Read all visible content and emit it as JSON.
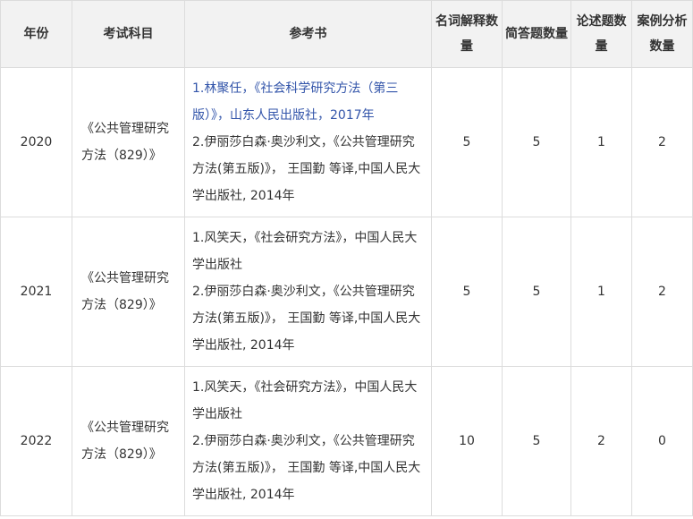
{
  "headers": [
    "年份",
    "考试科目",
    "参考书",
    "名词解释数量",
    "简答题数量",
    "论述题数量",
    "案例分析数量"
  ],
  "rows": [
    {
      "year": "2020",
      "subject": "《公共管理研究方法（829）》",
      "books": [
        "1.林聚任，《社会科学研究方法（第三版）》，山东人民出版社，2017年",
        "2.伊丽莎白森·奥沙利文，《公共管理研究方法(第五版)》， 王国勤 等译,中国人民大学出版社, 2014年"
      ],
      "noun": "5",
      "short": "5",
      "essay": "1",
      "case": "2"
    },
    {
      "year": "2021",
      "subject": "《公共管理研究方法（829）》",
      "books": [
        "1.风笑天，《社会研究方法》，中国人民大学出版社",
        "2.伊丽莎白森·奥沙利文，《公共管理研究方法(第五版)》， 王国勤 等译,中国人民大学出版社, 2014年"
      ],
      "noun": "5",
      "short": "5",
      "essay": "1",
      "case": "2"
    },
    {
      "year": "2022",
      "subject": "《公共管理研究方法（829）》",
      "books": [
        "1.风笑天，《社会研究方法》，中国人民大学出版社",
        "2.伊丽莎白森·奥沙利文，《公共管理研究方法(第五版)》， 王国勤 等译,中国人民大学出版社, 2014年"
      ],
      "noun": "10",
      "short": "5",
      "essay": "2",
      "case": "0"
    }
  ]
}
